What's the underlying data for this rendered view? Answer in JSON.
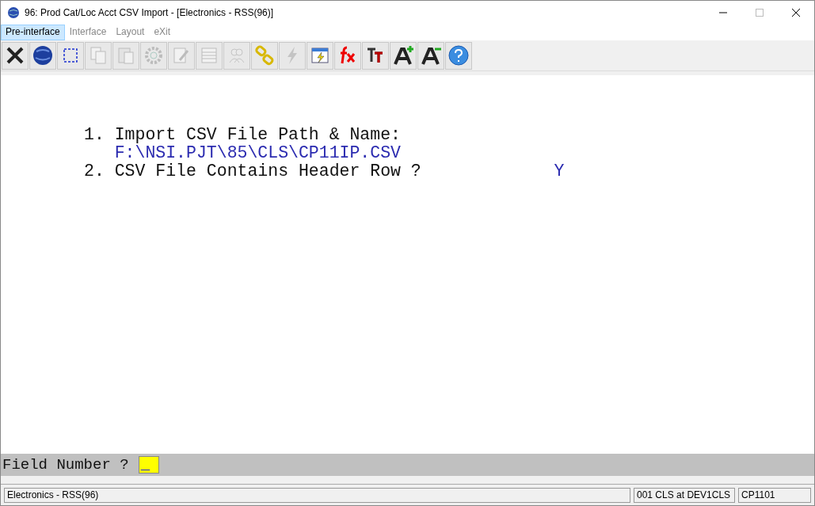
{
  "window": {
    "title": "96: Prod Cat/Loc Acct CSV Import - [Electronics - RSS(96)]"
  },
  "menu": [
    {
      "label": "Pre-interface",
      "selected": true,
      "disabled": false
    },
    {
      "label": "Interface",
      "selected": false,
      "disabled": true
    },
    {
      "label": "Layout",
      "selected": false,
      "disabled": true
    },
    {
      "label": "eXit",
      "selected": false,
      "disabled": true
    }
  ],
  "toolbar": [
    {
      "kind": "close",
      "disabled": false
    },
    {
      "kind": "globe",
      "disabled": false
    },
    {
      "kind": "select",
      "disabled": false
    },
    {
      "kind": "copy",
      "disabled": true
    },
    {
      "kind": "paste",
      "disabled": true
    },
    {
      "kind": "gear",
      "disabled": true
    },
    {
      "kind": "edit",
      "disabled": true
    },
    {
      "kind": "grid",
      "disabled": true
    },
    {
      "kind": "people",
      "disabled": true
    },
    {
      "kind": "link",
      "disabled": false
    },
    {
      "kind": "bolt",
      "disabled": true
    },
    {
      "kind": "window",
      "disabled": false
    },
    {
      "kind": "fx",
      "disabled": false
    },
    {
      "kind": "font",
      "disabled": false
    },
    {
      "kind": "bigger",
      "disabled": false
    },
    {
      "kind": "smaller",
      "disabled": false
    },
    {
      "kind": "help",
      "disabled": false
    }
  ],
  "fields": [
    {
      "number": "1.",
      "label": "Import CSV File Path & Name:",
      "value": "F:\\NSI.PJT\\85\\CLS\\CP11IP.CSV",
      "kind": "value_below"
    },
    {
      "number": "2.",
      "label": "CSV File Contains Header Row ?",
      "value": "Y",
      "kind": "value_inline"
    }
  ],
  "prompt": {
    "label": "Field Number ?",
    "value": "_"
  },
  "status_bar": [
    "Electronics - RSS(96)",
    "001 CLS at DEV1CLS",
    "CP1101"
  ]
}
